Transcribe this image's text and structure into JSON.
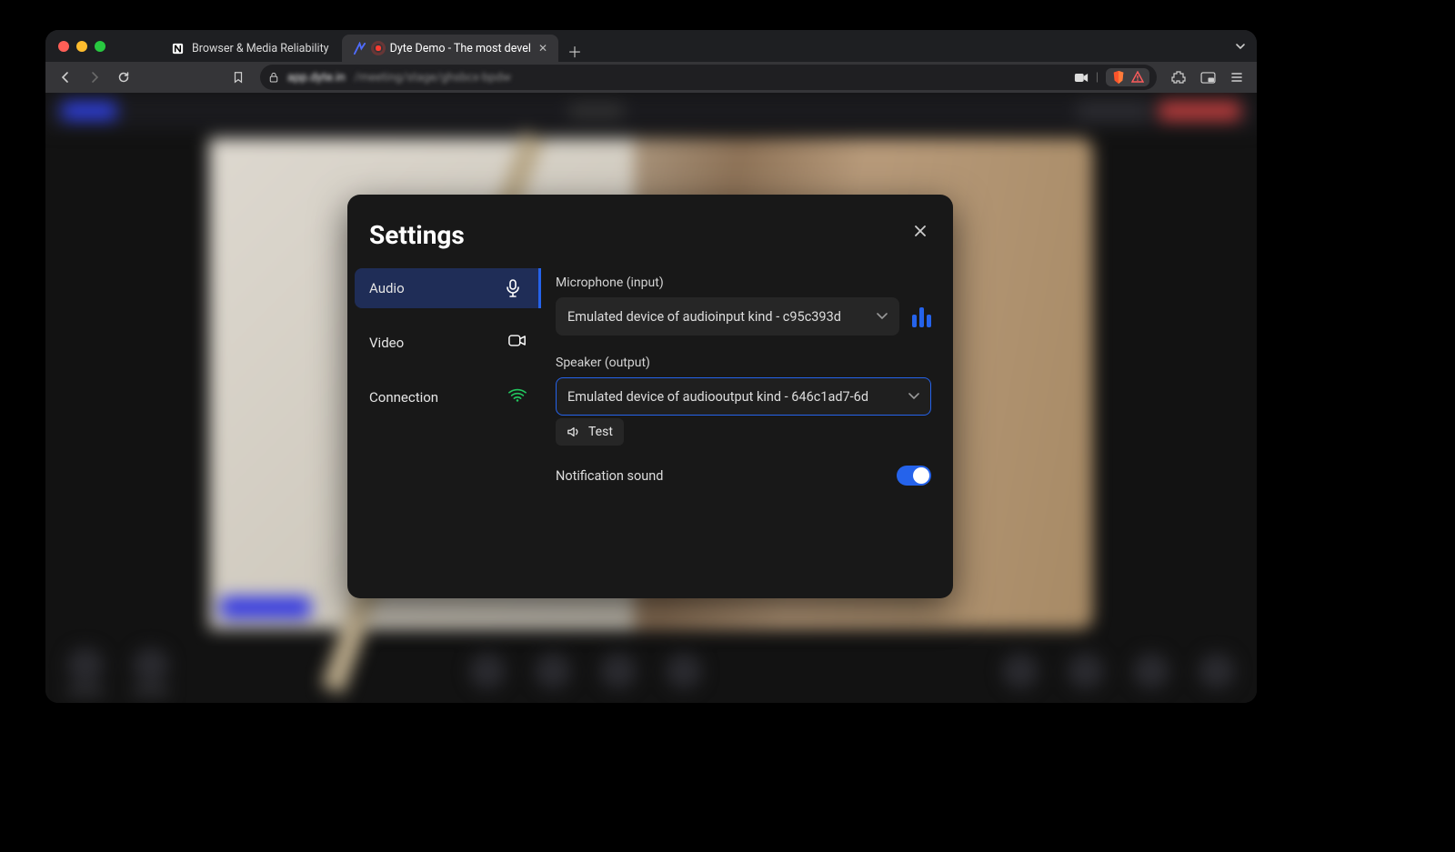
{
  "browser": {
    "tabs": [
      {
        "title": "Browser & Media Reliability",
        "favicon_name": "notion-icon"
      },
      {
        "title": "Dyte Demo - The most devel",
        "favicon_name": "dyte-icon",
        "recording": true
      }
    ],
    "url_domain": "app.dyte.in",
    "url_path": "/meeting/stage/ghsbcx-bpdw"
  },
  "modal": {
    "title": "Settings",
    "nav": {
      "audio": "Audio",
      "video": "Video",
      "connection": "Connection"
    },
    "audio_panel": {
      "mic_label": "Microphone (input)",
      "mic_value": "Emulated device of audioinput kind - c95c393d",
      "speaker_label": "Speaker (output)",
      "speaker_value": "Emulated device of audiooutput kind - 646c1ad7-6d",
      "test_label": "Test",
      "notif_label": "Notification sound",
      "notif_on": true
    }
  }
}
